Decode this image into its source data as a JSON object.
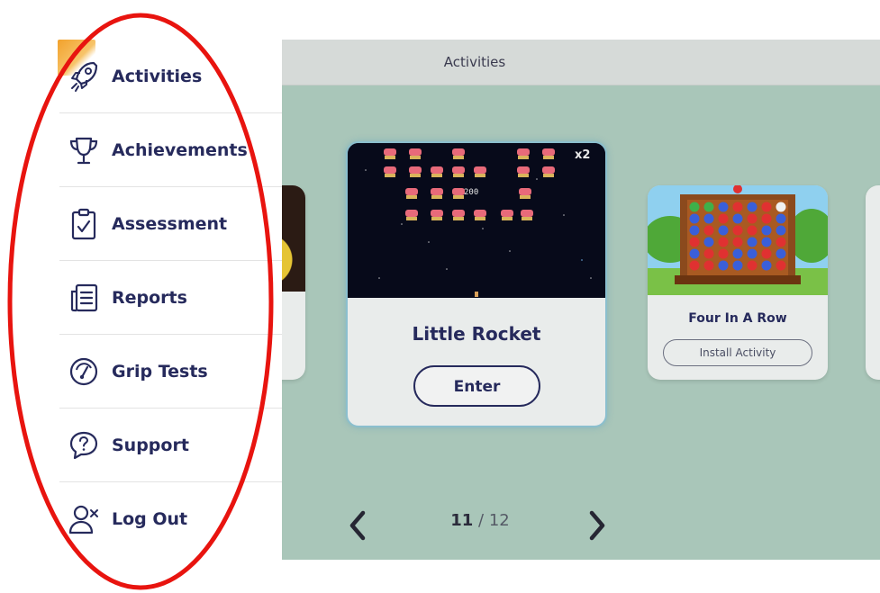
{
  "header": {
    "title": "Activities"
  },
  "menu": {
    "items": [
      {
        "label": "Activities",
        "icon": "rocket-icon"
      },
      {
        "label": "Achievements",
        "icon": "trophy-icon"
      },
      {
        "label": "Assessment",
        "icon": "clipboard-check-icon"
      },
      {
        "label": "Reports",
        "icon": "report-list-icon"
      },
      {
        "label": "Grip Tests",
        "icon": "gauge-icon"
      },
      {
        "label": "Support",
        "icon": "help-bubble-icon"
      },
      {
        "label": "Log Out",
        "icon": "user-remove-icon"
      }
    ]
  },
  "carousel": {
    "main_card": {
      "title": "Little Rocket",
      "button": "Enter",
      "multiplier": "x2",
      "score": "200"
    },
    "right_card": {
      "title": "Four In A Row",
      "button": "Install Activity"
    },
    "pager": {
      "current": "11",
      "separator": "/",
      "total": "12"
    }
  },
  "colors": {
    "accent_navy": "#262a5c",
    "app_background": "#a9c6b9",
    "annotation_red": "#e8140f"
  }
}
